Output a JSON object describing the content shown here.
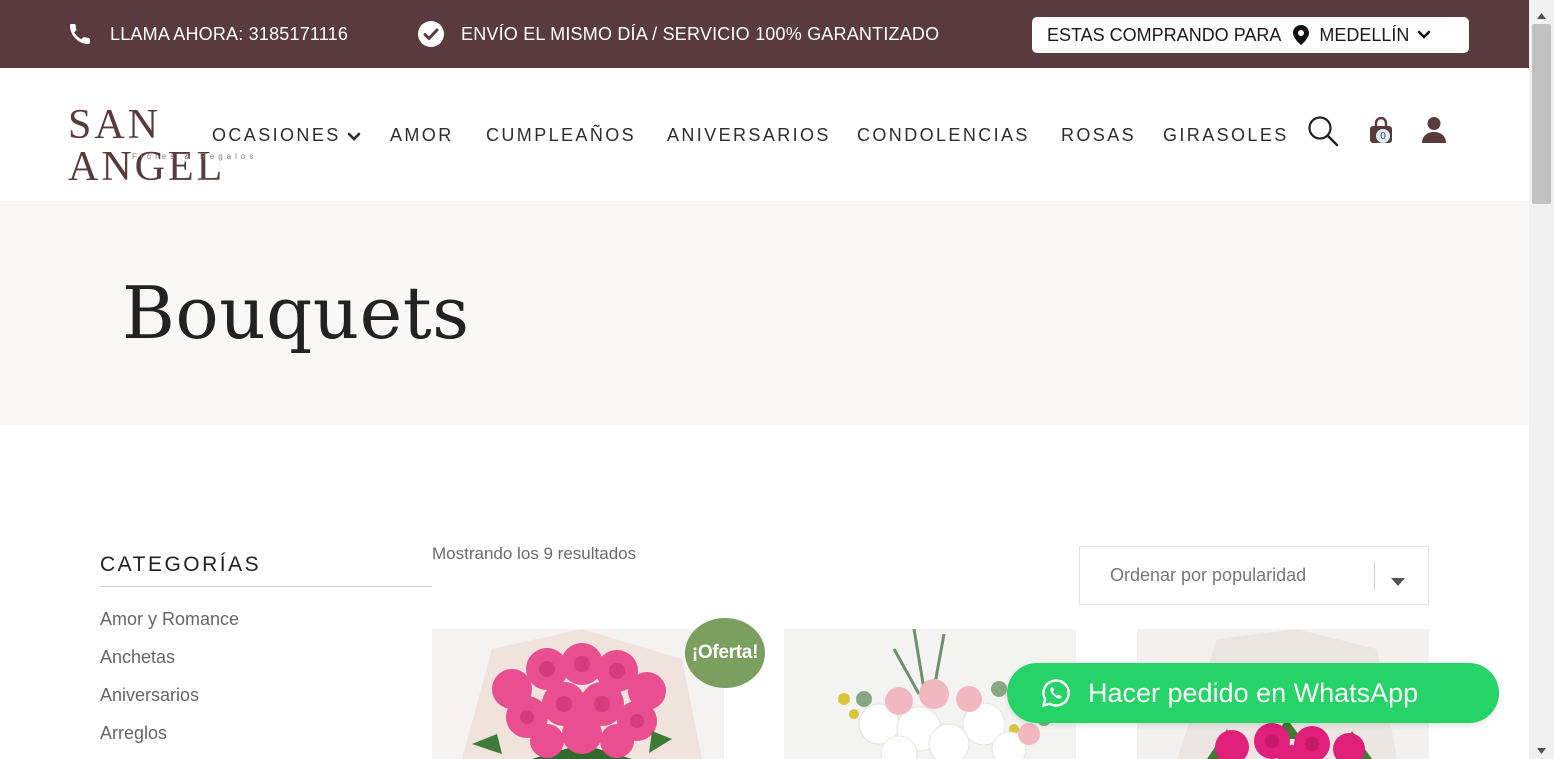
{
  "topbar": {
    "phone_text": "LLAMA AHORA: 3185171116",
    "shipping_text": "ENVÍO EL MISMO DÍA / SERVICIO 100% GARANTIZADO",
    "city_label": "ESTAS COMPRANDO PARA",
    "city_value": "MEDELLÍN"
  },
  "logo": {
    "brand": "SAN ANGEL",
    "tagline": "Flores & Regalos"
  },
  "nav": {
    "items": [
      "OCASIONES",
      "AMOR",
      "CUMPLEAÑOS",
      "ANIVERSARIOS",
      "CONDOLENCIAS",
      "ROSAS",
      "GIRASOLES"
    ],
    "cart_count": "0"
  },
  "hero": {
    "title": "Bouquets"
  },
  "sidebar": {
    "title": "CATEGORÍAS",
    "categories": [
      "Amor y Romance",
      "Anchetas",
      "Aniversarios",
      "Arreglos"
    ]
  },
  "results": {
    "count_text": "Mostrando los 9 resultados",
    "orderby_selected": "Ordenar por popularidad"
  },
  "products": {
    "sale_badge": "¡Oferta!"
  },
  "whatsapp": {
    "label": "Hacer pedido en WhatsApp"
  },
  "colors": {
    "brand": "#5a3b3d",
    "whatsapp": "#25d366",
    "sale": "#7a9f5f",
    "hero_bg": "#f9f8f6"
  },
  "icons": [
    "phone-icon",
    "check-circle-icon",
    "map-pin-icon",
    "chevron-down-icon",
    "search-icon",
    "shopping-bag-icon",
    "user-icon",
    "whatsapp-icon"
  ]
}
